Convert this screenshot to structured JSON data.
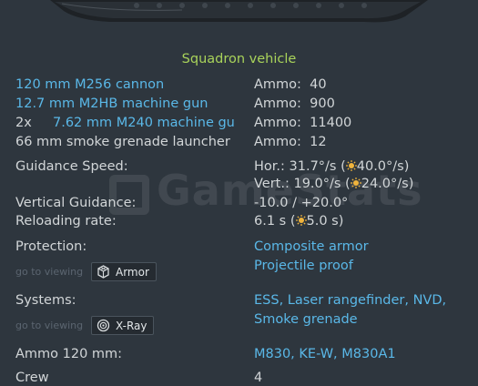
{
  "squadron_label": "Squadron vehicle",
  "weapons": [
    {
      "count": "",
      "name": "120 mm M256 cannon",
      "ammo_label": "Ammo:",
      "ammo": "40"
    },
    {
      "count": "",
      "name": "12.7 mm M2HB machine gun",
      "ammo_label": "Ammo:",
      "ammo": "900"
    },
    {
      "count": "2x",
      "name": "7.62 mm M240 machine gu",
      "ammo_label": "Ammo:",
      "ammo": "11400"
    },
    {
      "count": "",
      "name": "66 mm smoke grenade launcher",
      "ammo_label": "Ammo:",
      "ammo": "12"
    }
  ],
  "guidance_speed": {
    "label": "Guidance Speed:",
    "hor_prefix": "Hor.: 31.7°/s (",
    "hor_bonus": "40.0°/s)",
    "vert_prefix": "Vert.: 19.0°/s (",
    "vert_bonus": "24.0°/s)"
  },
  "vertical_guidance": {
    "label": "Vertical Guidance:",
    "value": "-10.0 / +20.0°"
  },
  "reloading_rate": {
    "label": "Reloading rate:",
    "prefix": "6.1 s (",
    "bonus": "5.0 s)"
  },
  "protection": {
    "label": "Protection:",
    "goto": "go to viewing",
    "button": "Armor",
    "values": [
      "Composite armor",
      "Projectile proof"
    ]
  },
  "systems": {
    "label": "Systems:",
    "goto": "go to viewing",
    "button": "X-Ray",
    "values": [
      "ESS, Laser rangefinder, NVD,",
      "Smoke grenade"
    ]
  },
  "ammo_120": {
    "label": "Ammo 120 mm:",
    "value": "M830, KE-W, M830A1"
  },
  "crew": {
    "label": "Crew",
    "value": "4"
  },
  "watermark": "GameStats",
  "colors": {
    "background": "#2e363e",
    "squadron_green": "#a9d35a",
    "link_blue": "#5ab8e8",
    "text": "#d2d6d8",
    "muted": "#5b6570"
  }
}
